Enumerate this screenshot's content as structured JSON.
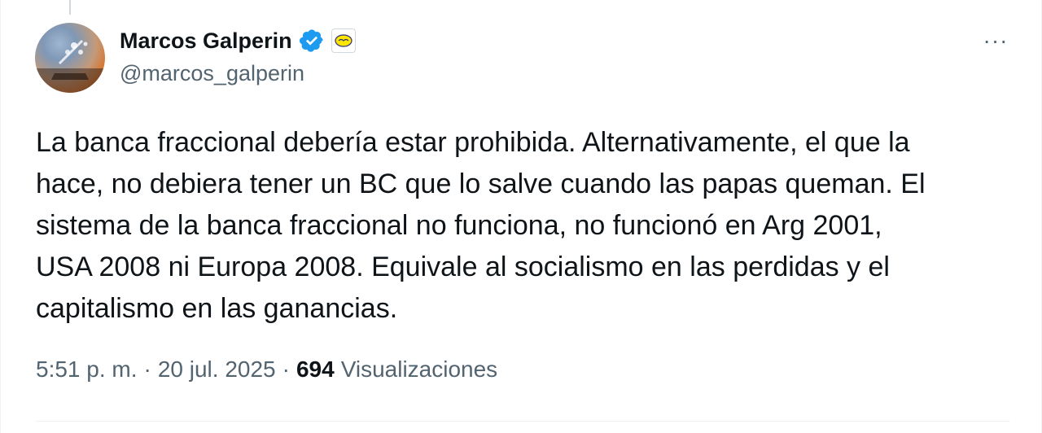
{
  "author": {
    "name": "Marcos Galperin",
    "handle": "@marcos_galperin",
    "verified_color": "#1d9bf0"
  },
  "more_icon_glyph": "···",
  "tweet": {
    "lines": [
      "La banca fraccional debería estar prohibida. Alternativamente, el que la",
      "hace, no debiera tener un BC que lo salve cuando las papas queman. El",
      "sistema de la banca fraccional no funciona, no funcionó en Arg 2001,",
      "USA 2008 ni Europa 2008. Equivale al socialismo en las perdidas y el",
      "capitalismo en las ganancias."
    ]
  },
  "meta": {
    "time": "5:51 p. m.",
    "separator": "·",
    "date": "20 jul. 2025",
    "views_count": "694",
    "views_label": "Visualizaciones"
  }
}
